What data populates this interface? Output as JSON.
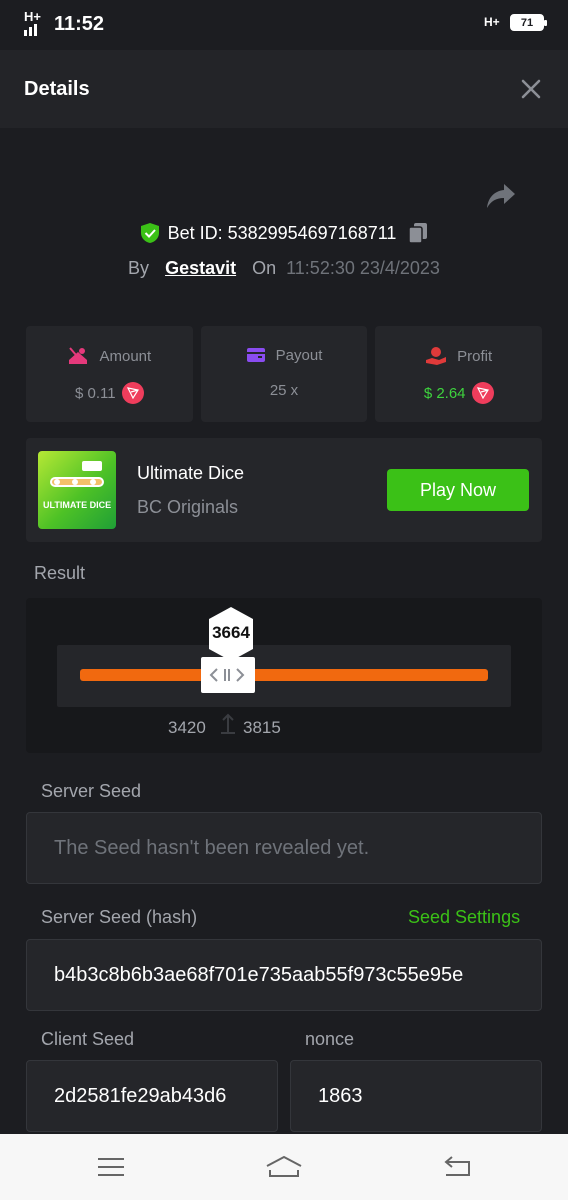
{
  "status": {
    "time": "11:52",
    "battery": "71",
    "signal_left": "H+",
    "signal_right": "H+"
  },
  "header": {
    "title": "Details"
  },
  "bet": {
    "id_text": "Bet ID: 53829954697168711",
    "by_label": "By",
    "username": "Gestavit",
    "on_label": "On",
    "datetime": "11:52:30 23/4/2023"
  },
  "stats": {
    "amount": {
      "label": "Amount",
      "value": "$ 0.11"
    },
    "payout": {
      "label": "Payout",
      "value": "25 x"
    },
    "profit": {
      "label": "Profit",
      "value": "$ 2.64"
    }
  },
  "game": {
    "name": "Ultimate Dice",
    "provider": "BC Originals",
    "play_label": "Play Now",
    "thumb_text": "ULTIMATE DICE"
  },
  "result": {
    "label": "Result",
    "value": "3664",
    "range_low": "3420",
    "range_high": "3815"
  },
  "server_seed": {
    "label": "Server Seed",
    "placeholder": "The Seed hasn't been revealed yet."
  },
  "server_seed_hash": {
    "label": "Server Seed (hash)",
    "settings_label": "Seed Settings",
    "value": "b4b3c8b6b3ae68f701e735aab55f973c55e95e"
  },
  "client_seed": {
    "label": "Client Seed",
    "value": "2d2581fe29ab43d6"
  },
  "nonce": {
    "label": "nonce",
    "value": "1863"
  },
  "colors": {
    "accent_green": "#3bc117",
    "profit_green": "#3ed33e",
    "slider_orange": "#f1690f",
    "trx_red": "#ef3d5c"
  }
}
